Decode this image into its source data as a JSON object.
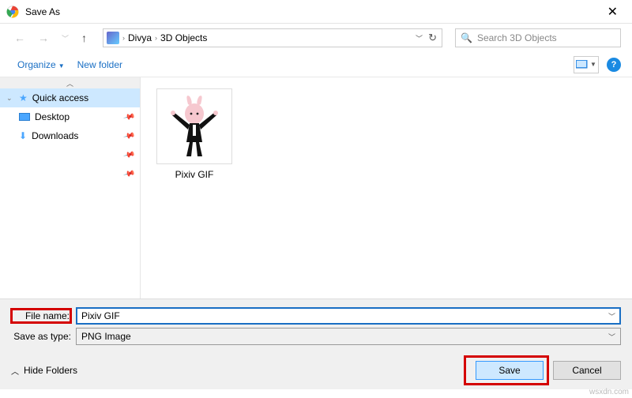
{
  "title": "Save As",
  "breadcrumb": {
    "seg1": "Divya",
    "seg2": "3D Objects"
  },
  "search": {
    "placeholder": "Search 3D Objects"
  },
  "toolbar": {
    "organize": "Organize",
    "newfolder": "New folder"
  },
  "sidebar": {
    "quick": "Quick access",
    "desktop": "Desktop",
    "downloads": "Downloads"
  },
  "content": {
    "file1": "Pixiv GIF"
  },
  "fields": {
    "name_label": "File name:",
    "name_value": "Pixiv GIF",
    "type_label": "Save as type:",
    "type_value": "PNG Image"
  },
  "actions": {
    "hide": "Hide Folders",
    "save": "Save",
    "cancel": "Cancel"
  },
  "watermark": "wsxdn.com"
}
